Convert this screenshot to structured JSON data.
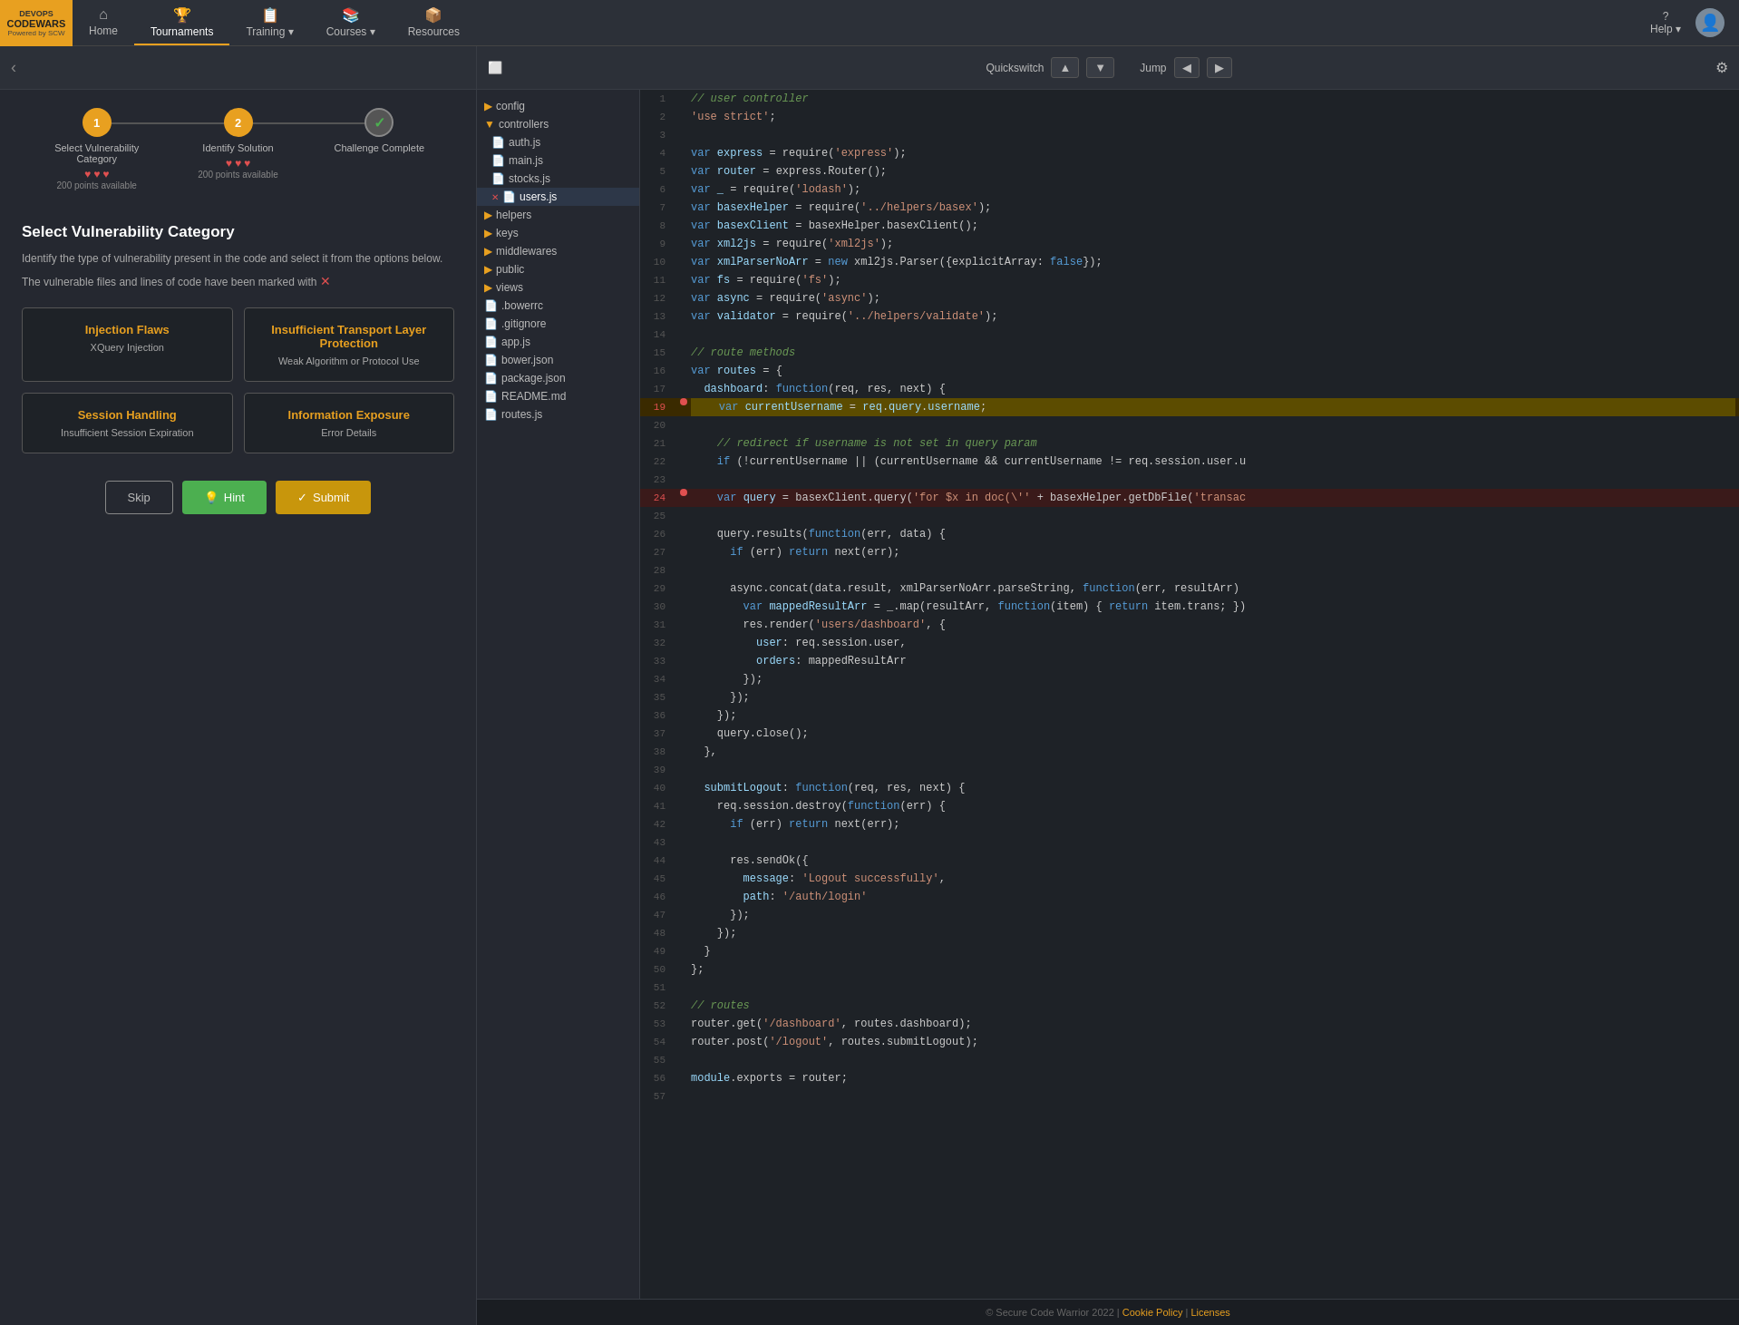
{
  "app": {
    "logo_top": "DEVOPS",
    "logo_brand": "CODEWARS",
    "logo_sub": "Powered by SCW"
  },
  "nav": {
    "items": [
      {
        "id": "home",
        "label": "Home",
        "icon": "⌂"
      },
      {
        "id": "tournaments",
        "label": "Tournaments",
        "icon": "🏆"
      },
      {
        "id": "training",
        "label": "Training ▾",
        "icon": "📋"
      },
      {
        "id": "courses",
        "label": "Courses ▾",
        "icon": "📚"
      },
      {
        "id": "resources",
        "label": "Resources",
        "icon": "📦"
      }
    ],
    "help_label": "Help ▾",
    "settings_icon": "⚙"
  },
  "left_panel": {
    "back_icon": "‹",
    "steps": [
      {
        "number": "1",
        "label": "Select Vulnerability Category",
        "state": "active",
        "hearts": 3,
        "points": "200 points available"
      },
      {
        "number": "2",
        "label": "Identify Solution",
        "state": "active",
        "hearts": 3,
        "points": "200 points available"
      },
      {
        "number": "✓",
        "label": "Challenge Complete",
        "state": "complete",
        "hearts": 0,
        "points": ""
      }
    ],
    "challenge": {
      "title": "Select Vulnerability Category",
      "description": "Identify the type of vulnerability present in the code and select it from the options below.",
      "description2": "The vulnerable files and lines of code have been marked with",
      "marker": "✕"
    },
    "options": [
      {
        "id": "injection-flaws",
        "title": "Injection Flaws",
        "subtitle": "XQuery Injection"
      },
      {
        "id": "transport-layer",
        "title": "Insufficient Transport Layer Protection",
        "subtitle": "Weak Algorithm or Protocol Use"
      },
      {
        "id": "session-handling",
        "title": "Session Handling",
        "subtitle": "Insufficient Session Expiration"
      },
      {
        "id": "information-exposure",
        "title": "Information Exposure",
        "subtitle": "Error Details"
      }
    ],
    "buttons": {
      "skip": "Skip",
      "hint": "Hint",
      "submit": "Submit",
      "hint_icon": "💡",
      "submit_icon": "✓"
    }
  },
  "editor": {
    "toolbar": {
      "expand_icon": "⬜",
      "quickswitch_label": "Quickswitch",
      "up_arrow": "▲",
      "down_arrow": "▼",
      "jump_label": "Jump",
      "left_arrow": "◀",
      "right_arrow": "▶",
      "settings_icon": "⚙"
    },
    "file_tree": [
      {
        "type": "folder",
        "name": "config",
        "indent": 0
      },
      {
        "type": "folder",
        "name": "controllers",
        "indent": 0,
        "open": true
      },
      {
        "type": "file",
        "name": "auth.js",
        "indent": 1
      },
      {
        "type": "file",
        "name": "main.js",
        "indent": 1
      },
      {
        "type": "file",
        "name": "stocks.js",
        "indent": 1
      },
      {
        "type": "file",
        "name": "users.js",
        "indent": 1,
        "active": true,
        "error": true
      },
      {
        "type": "folder",
        "name": "helpers",
        "indent": 0
      },
      {
        "type": "folder",
        "name": "keys",
        "indent": 0
      },
      {
        "type": "folder",
        "name": "middlewares",
        "indent": 0
      },
      {
        "type": "folder",
        "name": "public",
        "indent": 0
      },
      {
        "type": "folder",
        "name": "views",
        "indent": 0
      },
      {
        "type": "file",
        "name": ".bowerrc",
        "indent": 0
      },
      {
        "type": "file",
        "name": ".gitignore",
        "indent": 0
      },
      {
        "type": "file",
        "name": "app.js",
        "indent": 0
      },
      {
        "type": "file",
        "name": "bower.json",
        "indent": 0
      },
      {
        "type": "file",
        "name": "package.json",
        "indent": 0
      },
      {
        "type": "file",
        "name": "README.md",
        "indent": 0
      },
      {
        "type": "file",
        "name": "routes.js",
        "indent": 0
      }
    ],
    "footer": {
      "copyright": "© Secure Code Warrior 2022 |",
      "cookie_policy": "Cookie Policy",
      "separator": "|",
      "licenses": "Licenses"
    }
  }
}
